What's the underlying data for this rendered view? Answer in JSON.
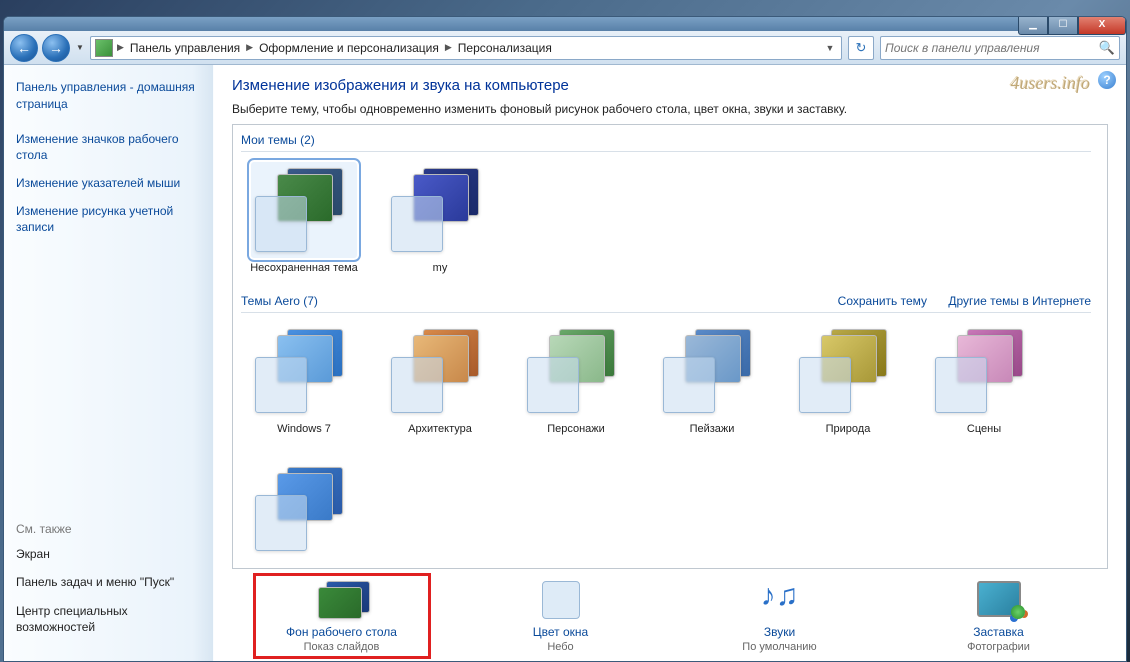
{
  "caption": {
    "min": "▁",
    "max": "☐",
    "close": "X"
  },
  "nav": {
    "back": "←",
    "forward": "→"
  },
  "breadcrumb": {
    "items": [
      "Панель управления",
      "Оформление и персонализация",
      "Персонализация"
    ]
  },
  "search": {
    "placeholder": "Поиск в панели управления"
  },
  "sidebar": {
    "home": "Панель управления - домашняя страница",
    "links": [
      "Изменение значков рабочего стола",
      "Изменение указателей мыши",
      "Изменение рисунка учетной записи"
    ],
    "see_also_title": "См. также",
    "see_also": [
      "Экран",
      "Панель задач и меню \"Пуск\"",
      "Центр специальных возможностей"
    ]
  },
  "page": {
    "title": "Изменение изображения и звука на компьютере",
    "subtitle": "Выберите тему, чтобы одновременно изменить фоновый рисунок рабочего стола, цвет окна, звуки и заставку."
  },
  "groups": {
    "my": {
      "header": "Мои темы (2)",
      "items": [
        "Несохраненная тема",
        "my"
      ]
    },
    "my_actions": {
      "save": "Сохранить тему",
      "online": "Другие темы в Интернете"
    },
    "aero": {
      "header": "Темы Aero (7)",
      "items": [
        "Windows 7",
        "Архитектура",
        "Персонажи",
        "Пейзажи",
        "Природа",
        "Сцены"
      ]
    }
  },
  "bottom": {
    "desktop": {
      "title": "Фон рабочего стола",
      "sub": "Показ слайдов"
    },
    "color": {
      "title": "Цвет окна",
      "sub": "Небо"
    },
    "sounds": {
      "title": "Звуки",
      "sub": "По умолчанию"
    },
    "saver": {
      "title": "Заставка",
      "sub": "Фотографии"
    }
  },
  "watermark": "4users.info"
}
